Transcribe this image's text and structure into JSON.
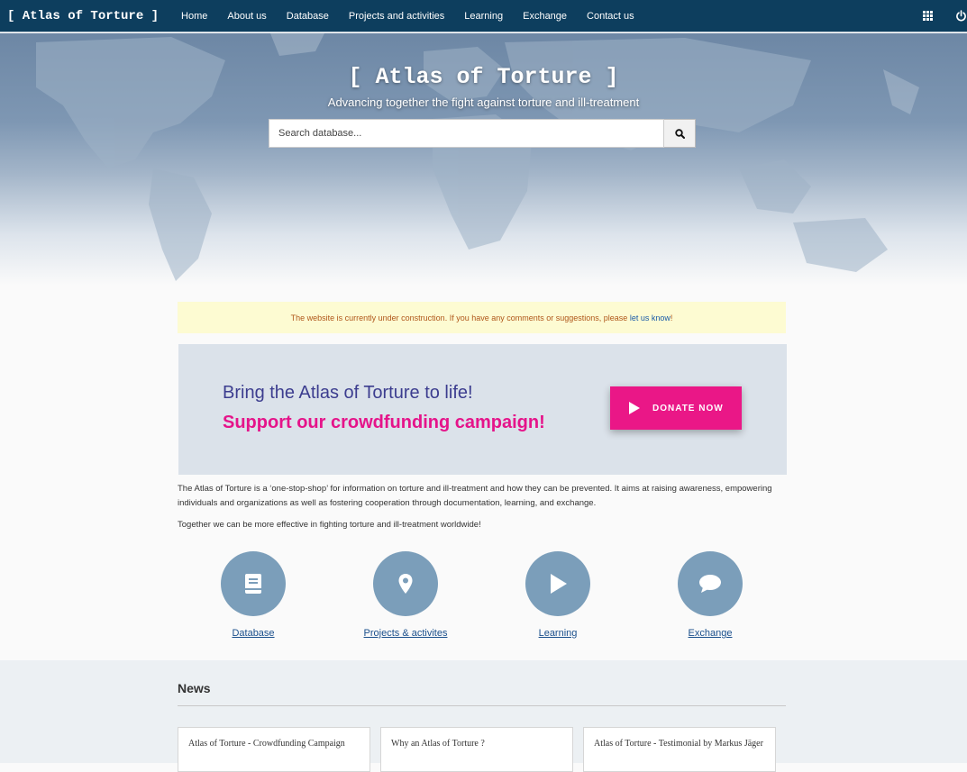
{
  "topbar": {
    "brand": "[ Atlas of Torture ]",
    "nav": [
      "Home",
      "About us",
      "Database",
      "Projects and activities",
      "Learning",
      "Exchange",
      "Contact us"
    ],
    "icons": {
      "apps": "grid-icon",
      "logout": "power-icon"
    }
  },
  "hero": {
    "title": "[ Atlas of Torture ]",
    "subtitle": "Advancing together the fight against torture and ill-treatment",
    "search": {
      "placeholder": "Search database...",
      "button_icon": "search-icon"
    }
  },
  "notice": {
    "text": "The website is currently under construction. If you have any comments or suggestions, please ",
    "link": "let us know",
    "suffix": "!"
  },
  "banner": {
    "line1": "Bring the Atlas of Torture to life!",
    "line2": "Support our crowdfunding campaign!",
    "donate_label": "DONATE NOW"
  },
  "intro": {
    "p1": "The Atlas of Torture is a ‘one-stop-shop’ for information on torture and ill-treatment and how they can be prevented. It aims at raising awareness, empowering individuals and organizations as well as fostering cooperation through documentation, learning, and exchange.",
    "p2": "Together we can be more effective in fighting torture and ill-treatment worldwide!"
  },
  "features": [
    {
      "label": "Database",
      "icon": "book-icon"
    },
    {
      "label": "Projects & activites",
      "icon": "map-pin-icon"
    },
    {
      "label": "Learning",
      "icon": "play-icon"
    },
    {
      "label": "Exchange",
      "icon": "chat-bubble-icon"
    }
  ],
  "news": {
    "title": "News",
    "cards": [
      "Atlas of Torture - Crowdfunding Campaign",
      "Why an Atlas of Torture ?",
      "Atlas of Torture - Testimonial by Markus Jäger"
    ]
  },
  "colors": {
    "topbar": "#0d3e5e",
    "accent_pink": "#ea1787",
    "feature_circle": "#7b9eba",
    "banner_bg": "#dbe2ea",
    "notice_bg": "#fdfbd2"
  }
}
